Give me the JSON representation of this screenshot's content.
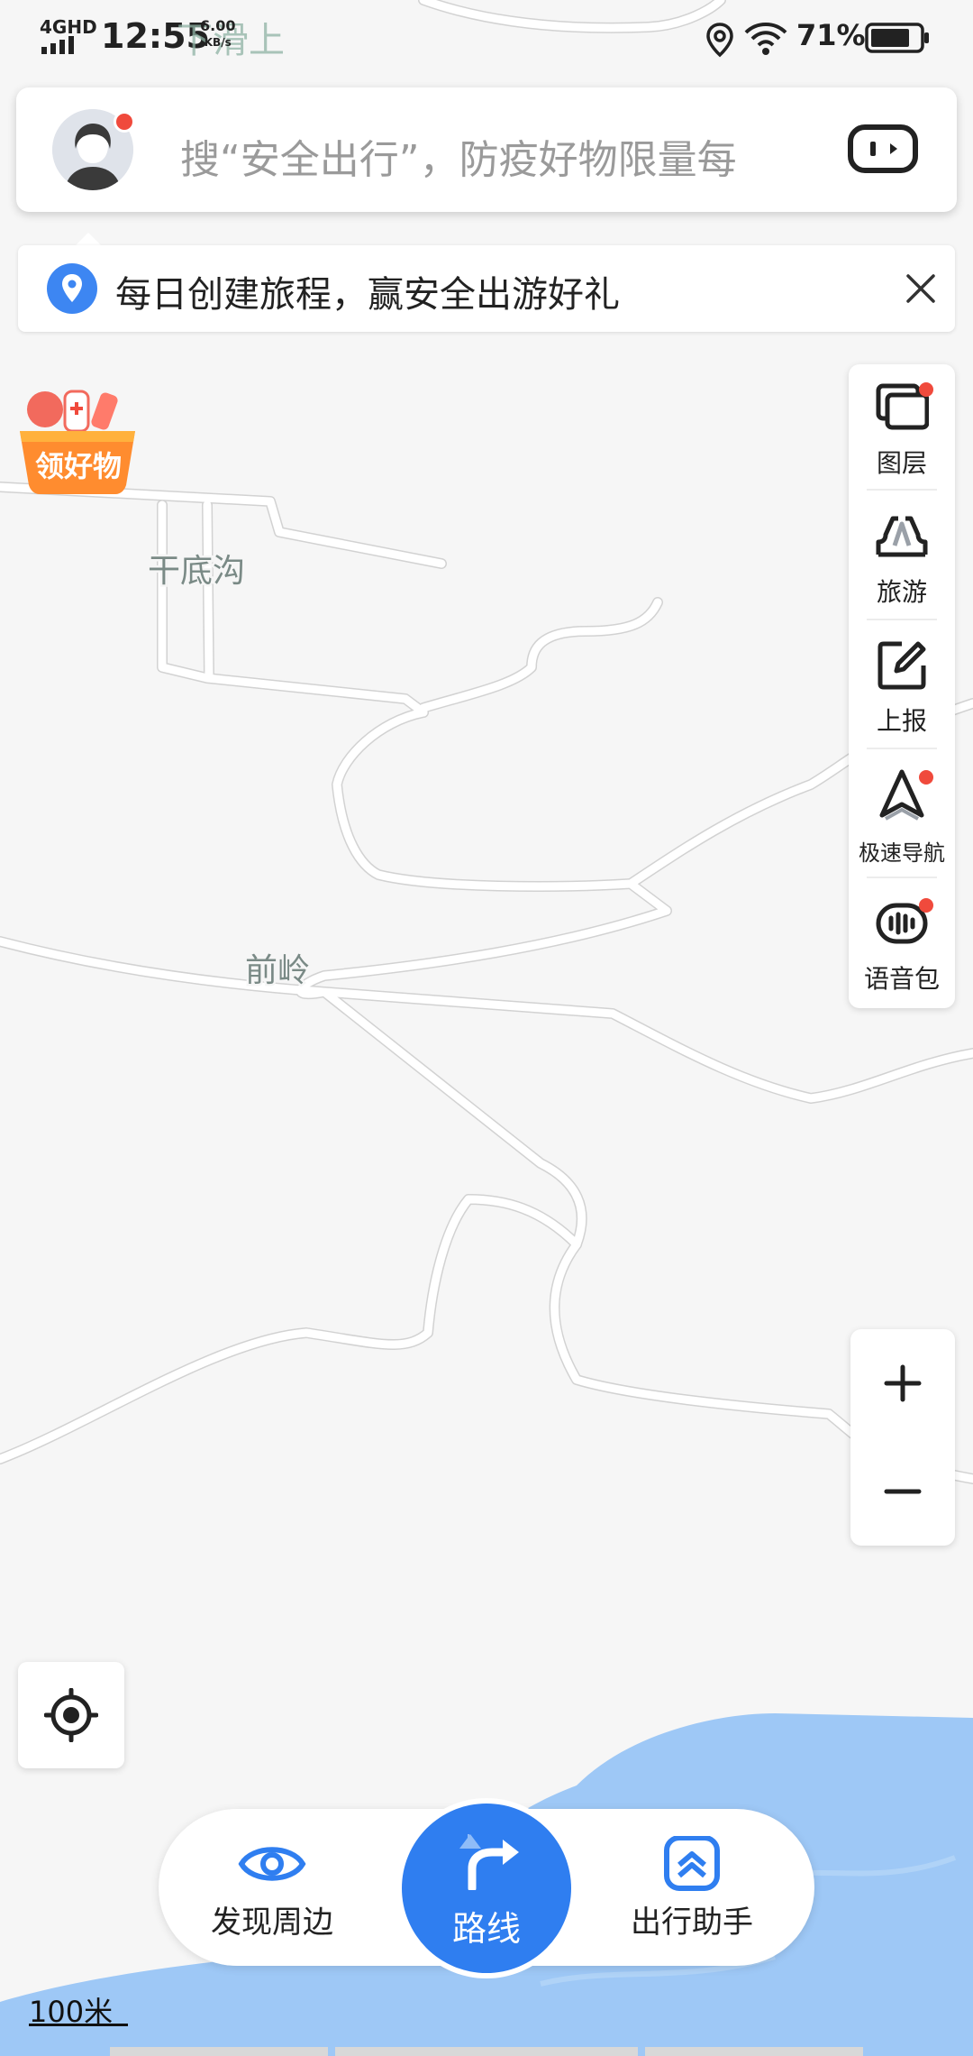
{
  "status_bar": {
    "network": "4GHD",
    "time": "12:55",
    "speed_value": "6.00",
    "speed_unit": "KB/s",
    "overlay_text": "下滑上",
    "battery_percent": "71%",
    "icons": [
      "signal-icon",
      "location-icon",
      "wifi-icon",
      "battery-icon"
    ]
  },
  "search": {
    "placeholder": "搜“安全出行”，防疫好物限量每",
    "avatar_icon": "user-avatar-icon",
    "right_icon": "robot-assistant-icon"
  },
  "notice": {
    "text": "每日创建旅程，赢安全出游好礼",
    "icon": "location-pin-icon",
    "close_icon": "close-icon"
  },
  "promo": {
    "label": "领好物",
    "icon": "gift-basket-icon"
  },
  "map": {
    "labels": [
      "干底沟",
      "前岭"
    ],
    "water_color": "#9ec8f6"
  },
  "tools": [
    {
      "label": "图层",
      "icon": "layers-icon",
      "badge": true
    },
    {
      "label": "旅游",
      "icon": "travel-icon",
      "badge": false
    },
    {
      "label": "上报",
      "icon": "report-edit-icon",
      "badge": false
    },
    {
      "label": "极速导航",
      "icon": "navigation-arrow-icon",
      "badge": true
    },
    {
      "label": "语音包",
      "icon": "voice-pack-icon",
      "badge": true
    }
  ],
  "zoom": {
    "in_icon": "zoom-in-icon",
    "out_icon": "zoom-out-icon"
  },
  "locate_icon": "locate-crosshair-icon",
  "dock": {
    "discover_label": "发现周边",
    "route_label": "路线",
    "assistant_label": "出行助手",
    "accent": "#2f7ef0"
  },
  "scale": {
    "label": "100米"
  }
}
